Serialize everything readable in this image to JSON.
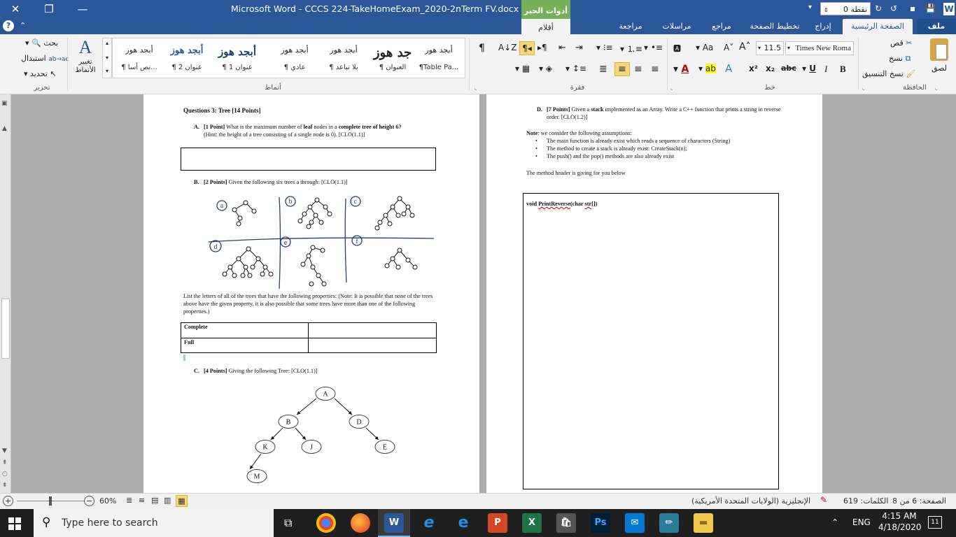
{
  "titlebar": {
    "title": "Microsoft Word  -  CCCS 224-TakeHomeExam_2020-2nTerm FV.docx",
    "tools_label": "أدوات الحبر",
    "tools_sub": "أقلام",
    "icon_word": "W",
    "font_size_box": "0 نقطة"
  },
  "tabs": {
    "file": "ملف",
    "home": "الصفحة الرئيسية",
    "insert": "إدراج",
    "layout": "تخطيط الصفحة",
    "references": "مراجع",
    "mailings": "مراسلات",
    "review": "مراجعة",
    "view": "عرض",
    "pens": "أقلام"
  },
  "ribbon": {
    "clipboard": {
      "label": "الحافظة",
      "paste": "لصق",
      "cut": "قص",
      "copy": "نسخ",
      "format_painter": "نسخ التنسيق"
    },
    "font": {
      "label": "خط",
      "name": "Times New Roma",
      "size": "11.5"
    },
    "paragraph": {
      "label": "فقرة"
    },
    "styles": {
      "label": "أنماط",
      "items": [
        {
          "preview": "أبجد هوز",
          "name": "¶Table Pa..."
        },
        {
          "preview": "جد هوز",
          "name": "¶ العنوان"
        },
        {
          "preview": "أبجد هوز",
          "name": "¶ بلا تباعد"
        },
        {
          "preview": "أبجد هوز",
          "name": "¶ عادي"
        },
        {
          "preview": "أبجد هوز",
          "name": "¶ عنوان 1"
        },
        {
          "preview": "أبجد هوز",
          "name": "¶ عنوان 2"
        },
        {
          "preview": "أبجد هوز",
          "name": "¶ نص أسا..."
        }
      ],
      "change_styles": "تغيير الأنماط"
    },
    "editing": {
      "label": "تحرير",
      "find": "بحث",
      "replace": "استبدال",
      "select": "تحديد"
    }
  },
  "left_page": {
    "q3_title": "Questions 3: Tree [14 Points]",
    "qa_label": "A.",
    "qa_points": "[1 Point]",
    "qa_text1": " What is the maximum number of ",
    "qa_bold1": "leaf",
    "qa_text2": " nodes in a ",
    "qa_bold2": "complete tree of height 6?",
    "qa_hint": "(Hint: the height of a tree consisting of a single node is 0). [CLO(1.1)]",
    "qb_label": "B.",
    "qb_points": "[2 Points]",
    "qb_text": " Given the following six trees a through: [CLO(1.1)]",
    "tree_letters": [
      "a",
      "b",
      "c",
      "d",
      "e",
      "f"
    ],
    "list_text": "List the letters of all of the trees that have the following properties: (Note: It is possible that none of the trees above have the given property, it is also possible that some trees have more than one of the following properties.)",
    "table_rows": [
      "Complete",
      "Full"
    ],
    "qc_label": "C.",
    "qc_points": "[4 Points]",
    "qc_text": " Giving the following Tree: [CLO(1.1)]",
    "tree_nodes": [
      "A",
      "B",
      "D",
      "K",
      "J",
      "E",
      "M"
    ]
  },
  "right_page": {
    "qd_label": "D.",
    "qd_points": "[7 Points]",
    "qd_text1": " Given a ",
    "qd_bold": "stack",
    "qd_text2": " implemented as an Array. Write a C++ function that prints a string in reverse order. [CLO(1.2)]",
    "note_label": "Note",
    "note_text": ": we consider the following assumptions:",
    "bullets": [
      "The main function is already exist which reads a sequence of characters (String)",
      "The method to create a stack is already exist: CreateStack(n);",
      "The push() and the pop() methods are also already exist"
    ],
    "method_text": "The method header is giving for you below",
    "code_prefix": "void ",
    "code_fn": "PrintReverse",
    "code_args_a": "(char ",
    "code_args_b": "str",
    "code_args_c": "[])"
  },
  "status": {
    "page": "الصفحة: 6 من 8",
    "words": "الكلمات: 619",
    "language": "الإنجليزية (الولايات المتحدة الأمريكية)",
    "zoom": "60%"
  },
  "taskbar": {
    "search_placeholder": "Type here to search",
    "lang": "ENG",
    "time": "4:15 AM",
    "date": "4/18/2020",
    "notif_count": "11"
  }
}
